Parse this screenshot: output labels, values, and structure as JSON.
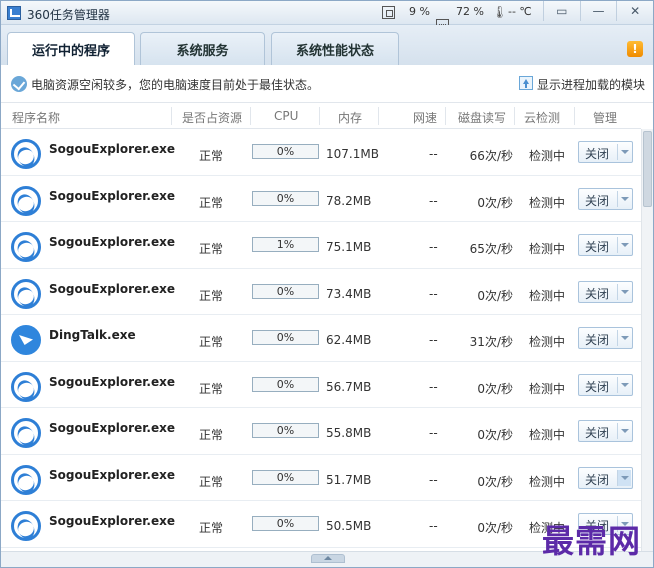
{
  "window": {
    "title": "360任务管理器",
    "cpu_percent": "9 %",
    "mem_percent": "72 %",
    "temperature": "-- ℃",
    "buttons": [
      "▭",
      "—",
      "✕"
    ]
  },
  "tabs": [
    {
      "label": "运行中的程序",
      "active": true
    },
    {
      "label": "系统服务",
      "active": false
    },
    {
      "label": "系统性能状态",
      "active": false
    }
  ],
  "notify_badge": "!",
  "status": {
    "message": "电脑资源空闲较多，您的电脑速度目前处于最佳状态。",
    "show_modules": "显示进程加载的模块"
  },
  "columns": {
    "name": "程序名称",
    "resource": "是否占资源",
    "cpu": "CPU",
    "memory": "内存",
    "network": "网速",
    "disk": "磁盘读写",
    "cloud": "云检测",
    "manage": "管理"
  },
  "processes": [
    {
      "icon": "sogou-explorer-icon",
      "name": "SogouExplorer.exe",
      "resource": "正常",
      "cpu": "0%",
      "memory": "107.1MB",
      "network": "--",
      "disk": "66次/秒",
      "cloud": "检测中",
      "action": "关闭"
    },
    {
      "icon": "sogou-explorer-icon",
      "name": "SogouExplorer.exe",
      "resource": "正常",
      "cpu": "0%",
      "memory": "78.2MB",
      "network": "--",
      "disk": "0次/秒",
      "cloud": "检测中",
      "action": "关闭"
    },
    {
      "icon": "sogou-explorer-icon",
      "name": "SogouExplorer.exe",
      "resource": "正常",
      "cpu": "1%",
      "memory": "75.1MB",
      "network": "--",
      "disk": "65次/秒",
      "cloud": "检测中",
      "action": "关闭"
    },
    {
      "icon": "sogou-explorer-icon",
      "name": "SogouExplorer.exe",
      "resource": "正常",
      "cpu": "0%",
      "memory": "73.4MB",
      "network": "--",
      "disk": "0次/秒",
      "cloud": "检测中",
      "action": "关闭"
    },
    {
      "icon": "dingtalk-icon",
      "name": "DingTalk.exe",
      "resource": "正常",
      "cpu": "0%",
      "memory": "62.4MB",
      "network": "--",
      "disk": "31次/秒",
      "cloud": "检测中",
      "action": "关闭"
    },
    {
      "icon": "sogou-explorer-icon",
      "name": "SogouExplorer.exe",
      "resource": "正常",
      "cpu": "0%",
      "memory": "56.7MB",
      "network": "--",
      "disk": "0次/秒",
      "cloud": "检测中",
      "action": "关闭"
    },
    {
      "icon": "sogou-explorer-icon",
      "name": "SogouExplorer.exe",
      "resource": "正常",
      "cpu": "0%",
      "memory": "55.8MB",
      "network": "--",
      "disk": "0次/秒",
      "cloud": "检测中",
      "action": "关闭"
    },
    {
      "icon": "sogou-explorer-icon",
      "name": "SogouExplorer.exe",
      "resource": "正常",
      "cpu": "0%",
      "memory": "51.7MB",
      "network": "--",
      "disk": "0次/秒",
      "cloud": "检测中",
      "action": "关闭"
    },
    {
      "icon": "sogou-explorer-icon",
      "name": "SogouExplorer.exe",
      "resource": "正常",
      "cpu": "0%",
      "memory": "50.5MB",
      "network": "--",
      "disk": "0次/秒",
      "cloud": "检测中",
      "action": "关闭"
    }
  ],
  "watermark": "最需网",
  "colors": {
    "accent": "#2e7fd6",
    "notify": "#f08b00",
    "watermark": "#5c2aa8"
  }
}
